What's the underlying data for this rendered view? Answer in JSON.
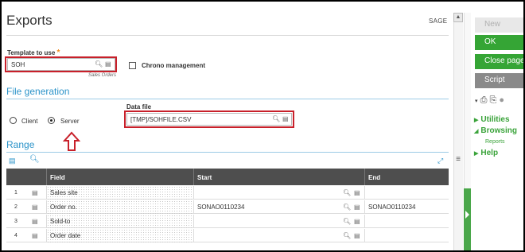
{
  "header": {
    "title": "Exports",
    "brand": "SAGE"
  },
  "template": {
    "label": "Template to use",
    "required_mark": "*",
    "value": "SOH",
    "description": "Sales Orders",
    "chrono_label": "Chrono management",
    "chrono_checked": false
  },
  "generation": {
    "section_title": "File generation",
    "client_label": "Client",
    "server_label": "Server",
    "selected": "Server",
    "datafile_label": "Data file",
    "datafile_value": "[TMP]/SOHFILE.CSV"
  },
  "range": {
    "section_title": "Range",
    "columns": {
      "field": "Field",
      "start": "Start",
      "end": "End"
    },
    "rows": [
      {
        "num": "1",
        "field": "Sales site",
        "start": "",
        "end": ""
      },
      {
        "num": "2",
        "field": "Order no.",
        "start": "SONAO0110234",
        "end": "SONAO0110234"
      },
      {
        "num": "3",
        "field": "Sold-to",
        "start": "",
        "end": ""
      },
      {
        "num": "4",
        "field": "Order date",
        "start": "",
        "end": ""
      }
    ]
  },
  "actions": {
    "new": "New",
    "ok": "OK",
    "close": "Close page",
    "script": "Script",
    "utilities": "Utilities",
    "browsing": "Browsing",
    "reports": "Reports",
    "help": "Help"
  },
  "icons": {
    "search": "magnifier",
    "lookup": "selection-list",
    "expand": "expand-arrows",
    "print": "printer",
    "attach": "paperclip",
    "comment": "speech-bubble"
  },
  "colors": {
    "accent_blue": "#2b93c9",
    "action_green": "#35a535",
    "highlight_red": "#c8202a",
    "table_header": "#4e4e4e",
    "required_orange": "#f08a1e"
  }
}
